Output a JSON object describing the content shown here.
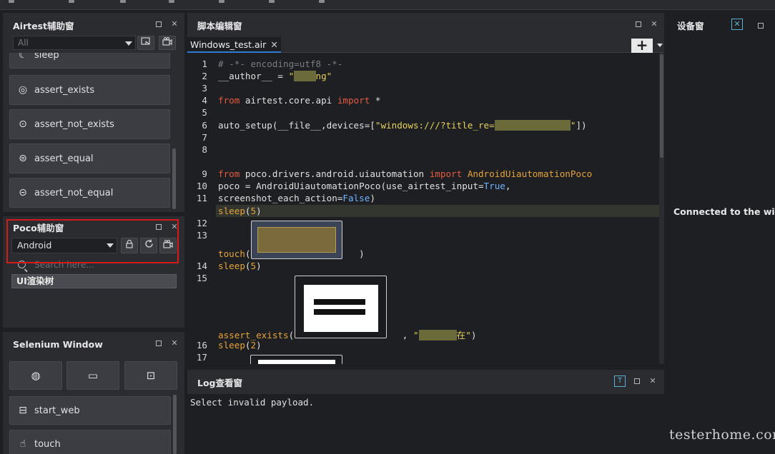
{
  "airtest": {
    "title": "Airtest辅助窗",
    "filter_value": "All",
    "items": [
      {
        "label": "sleep"
      },
      {
        "label": "assert_exists"
      },
      {
        "label": "assert_not_exists"
      },
      {
        "label": "assert_equal"
      },
      {
        "label": "assert_not_equal"
      }
    ]
  },
  "poco": {
    "title": "Poco辅助窗",
    "platform": "Android",
    "search_placeholder": "Search here...",
    "tree_item": "UI渲染树"
  },
  "selenium": {
    "title": "Selenium Window",
    "items": [
      {
        "label": "start_web"
      },
      {
        "label": "touch"
      }
    ]
  },
  "editor": {
    "title": "脚本编辑窗",
    "tab_label": "Windows_test.air",
    "tab_close": "✕",
    "add_label": "+",
    "line_numbers": [
      "1",
      "2",
      "3",
      "4",
      "5",
      "6",
      "7",
      "8",
      "9",
      "10",
      "11",
      "",
      "12",
      "13",
      "",
      "14",
      "15",
      "",
      "",
      "",
      "",
      "16",
      "17"
    ]
  },
  "log": {
    "title": "Log查看窗",
    "message": "Select invalid payload."
  },
  "device": {
    "title": "设备窗",
    "status": "Connected to the window"
  },
  "watermark": "testerhome.com",
  "colors": {
    "accent": "#2f7bd6",
    "highlight_box": "#d41a1a",
    "keyword": "#e65a3f",
    "string": "#e6d15a"
  }
}
